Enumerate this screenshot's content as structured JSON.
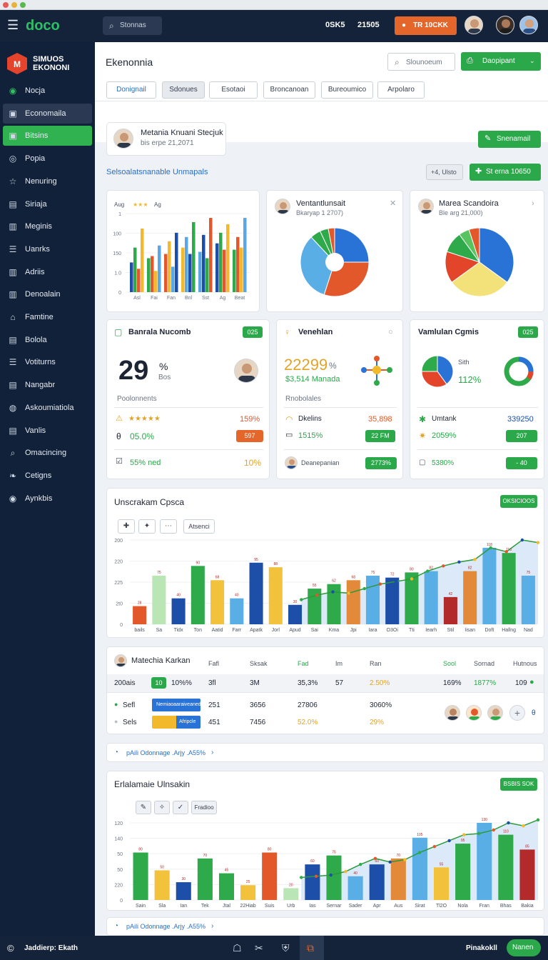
{
  "topbar": {
    "brand": "doco",
    "counter1": "0SK5",
    "counter2": "21505",
    "search_label": "Stonnas",
    "cta_label": "TR 10CKK"
  },
  "sidebar": {
    "logo_line1": "SIMUOS",
    "logo_line2": "EKONONI",
    "items": [
      {
        "label": "Nocja",
        "icon": "record-icon"
      },
      {
        "label": "Economaila",
        "icon": "square-icon"
      },
      {
        "label": "Bitsins",
        "icon": "square-icon"
      },
      {
        "label": "Popia",
        "icon": "compass-icon"
      },
      {
        "label": "Nenuring",
        "icon": "star-icon"
      },
      {
        "label": "Siriaja",
        "icon": "doc-icon"
      },
      {
        "label": "Meginis",
        "icon": "chart-icon"
      },
      {
        "label": "Uanrks",
        "icon": "list-icon"
      },
      {
        "label": "Adriis",
        "icon": "chart-icon"
      },
      {
        "label": "Denoalain",
        "icon": "chart-icon"
      },
      {
        "label": "Famtine",
        "icon": "home-icon"
      },
      {
        "label": "Bolola",
        "icon": "doc-icon"
      },
      {
        "label": "Votiturns",
        "icon": "list-icon"
      },
      {
        "label": "Nangabr",
        "icon": "doc-icon"
      },
      {
        "label": "Askoumiatiola",
        "icon": "globe-icon"
      },
      {
        "label": "Vanlis",
        "icon": "doc-icon"
      },
      {
        "label": "Omacincing",
        "icon": "search-icon"
      },
      {
        "label": "Cetigns",
        "icon": "leaf-icon"
      },
      {
        "label": "Aynkbis",
        "icon": "record-icon"
      }
    ]
  },
  "header": {
    "title": "Ekenonnia",
    "search_placeholder": "Slounoeum",
    "primary_label": "Daopipant"
  },
  "filters": [
    "Donignail",
    "Sdonues",
    "Esotaoi",
    "Broncanoan",
    "Bureoumico",
    "Arpolaro"
  ],
  "profile": {
    "name": "Metania Knuani Stecjuk",
    "sub": "bis erpe 21,2071"
  },
  "section": {
    "label": "Selsoalatsnanable Unmapals",
    "counter": "+4, Ulsto",
    "action": "St erna 10650",
    "top_button": "Snenamail"
  },
  "chart_data": [
    {
      "type": "bar",
      "title": "Aug",
      "legend": "Ag",
      "categories": [
        "Asl",
        "Fai",
        "Fan",
        "Bnl",
        "Sst",
        "Ag",
        "Beat"
      ],
      "yticks": [
        "1",
        "100",
        "150",
        "1.0",
        "0"
      ],
      "series": [
        {
          "values": [
            28,
            32,
            36,
            42,
            38,
            46,
            40
          ]
        },
        {
          "values": [
            42,
            34,
            48,
            52,
            54,
            56,
            52
          ]
        },
        {
          "values": [
            22,
            20,
            24,
            36,
            32,
            40,
            42
          ]
        },
        {
          "values": [
            60,
            44,
            56,
            66,
            70,
            64,
            70
          ]
        }
      ],
      "colors": [
        "#1e4fa8",
        "#2eaa4a",
        "#e2582a",
        "#f2b92c",
        "#5aa7e6"
      ]
    },
    {
      "type": "pie",
      "values": [
        25,
        30,
        33,
        5,
        4,
        3
      ],
      "colors": [
        "#2a73d6",
        "#e2582a",
        "#5aaee6",
        "#2eaa4a",
        "#2eaa4a",
        "#e2582a"
      ]
    },
    {
      "type": "pie",
      "values": [
        35,
        30,
        15,
        10,
        5,
        5
      ],
      "colors": [
        "#2a73d6",
        "#f3e27a",
        "#e2452a",
        "#2eaa4a",
        "#58c460",
        "#e2582a"
      ]
    },
    {
      "type": "bar-line",
      "title": "Unscrakam Cpsca",
      "action": "OKSICIOOS",
      "categories": [
        "bails",
        "Sa",
        "Tidx",
        "Ton",
        "Aatid",
        "Farr",
        "Apatk",
        "Jorl",
        "Apud",
        "Sai",
        "Kma",
        "Jpi",
        "Iara",
        "O3Oi",
        "Tti",
        "Iearh",
        "Stil",
        "Iisan",
        "Doft",
        "Hallng",
        "Nad"
      ],
      "yticks": [
        "200",
        "220",
        "225",
        "2t0",
        "0"
      ],
      "bars": [
        28,
        75,
        40,
        90,
        68,
        40,
        95,
        88,
        30,
        55,
        62,
        68,
        75,
        72,
        80,
        82,
        42,
        82,
        118,
        110,
        75
      ],
      "colors": [
        "#e2582a",
        "#b9e6b4",
        "#1e4fa8",
        "#2eaa4a",
        "#f2c23c",
        "#5aaee6",
        "#1e4fa8",
        "#f2c23c",
        "#1e4fa8",
        "#2eaa4a",
        "#2eaa4a",
        "#e2893a",
        "#5aaee6",
        "#1e4fa8",
        "#2eaa4a",
        "#5aaee6",
        "#b22a2a",
        "#e2893a",
        "#5aaee6",
        "#2eaa4a",
        "#5aaee6"
      ],
      "line": [
        38,
        45,
        50,
        48,
        55,
        62,
        66,
        70,
        82,
        90,
        96,
        100,
        118,
        112,
        130,
        126
      ]
    },
    {
      "type": "bar-line",
      "title": "Erlalamaie Ulnsakin",
      "action": "BSBIS SOK",
      "categories": [
        "Sain",
        "Sla",
        "Ian",
        "Tek",
        "Jtal",
        "22Hiab",
        "Suis",
        "Urb",
        "Ias",
        "Sernar",
        "Sader",
        "Apr",
        "Aus",
        "Sirat",
        "Tl2O",
        "Nola",
        "Fran",
        "Bhas",
        "Bakia"
      ],
      "yticks": [
        "120",
        "140",
        "50",
        "50",
        "220",
        "0"
      ],
      "bars": [
        80,
        50,
        30,
        70,
        45,
        25,
        80,
        20,
        60,
        75,
        40,
        60,
        70,
        105,
        55,
        95,
        130,
        110,
        85
      ],
      "colors": [
        "#2eaa4a",
        "#f2c23c",
        "#1e4fa8",
        "#2eaa4a",
        "#2eaa4a",
        "#f2c23c",
        "#e2582a",
        "#b9e6b4",
        "#1e4fa8",
        "#2eaa4a",
        "#5aaee6",
        "#1e4fa8",
        "#e2893a",
        "#5aaee6",
        "#f2c23c",
        "#2eaa4a",
        "#5aaee6",
        "#2eaa4a",
        "#b22a2a"
      ],
      "line": [
        38,
        40,
        42,
        48,
        60,
        70,
        64,
        68,
        80,
        90,
        100,
        110,
        112,
        118,
        130,
        125,
        135
      ]
    }
  ],
  "kpi": [
    {
      "title": "Banrala Nucomb",
      "badge": "025",
      "value": "29",
      "unit": "%",
      "sub": "Bos",
      "caption": "Poolonnents",
      "rows": [
        {
          "label": "★★★★★",
          "value": "159%"
        },
        {
          "label": "05.0%",
          "value": "597"
        },
        {
          "label": "55% ned",
          "value": "10%"
        }
      ]
    },
    {
      "title": "Venehlan",
      "badge": "",
      "value": "22299",
      "unit": "%",
      "sub": "$3,514 Manada",
      "caption": "Rnobolales",
      "rows": [
        {
          "label": "Dkelins",
          "value": "35,898"
        },
        {
          "label": "1515%",
          "value": "22 FM"
        },
        {
          "label": "Deanepanian",
          "value": "2773%"
        }
      ]
    },
    {
      "title": "Vamlulan Cgmis",
      "badge": "025",
      "value": "",
      "sub": "Sith",
      "pct": "112%",
      "caption": "",
      "rows": [
        {
          "label": "Umtank",
          "value": "339250"
        },
        {
          "label": "2059%",
          "value": "207"
        },
        {
          "label": "5380%",
          "value": "- 40"
        }
      ]
    }
  ],
  "mini_cards": [
    {
      "name": "Ventantlunsait",
      "sub": "Bkaryap 1 2707)"
    },
    {
      "name": "Marea Scandoira",
      "sub": "Ble arg 21,000)"
    }
  ],
  "chart_toolbar": {
    "a": "✚",
    "b": "✦",
    "c": "⋯",
    "d": "Atsenci",
    "e": "✎",
    "f": "✧",
    "g": "✓",
    "h": "Fradioo"
  },
  "table": {
    "title": "Matechia Karkan",
    "headers": [
      "Fafl",
      "Sksak",
      "Fad",
      "Im",
      "Ran",
      "Sool",
      "Sornad",
      "Hutnous"
    ],
    "row1": [
      "200ais",
      "10",
      "10%%",
      "3fl",
      "3M",
      "35,3%",
      "57",
      "2.50%",
      "169%",
      "1877%",
      "109"
    ],
    "row2": [
      "Sefl",
      "251",
      "3656",
      "27806",
      "3060%"
    ],
    "row3": [
      "Sels",
      "451",
      "7456",
      "52.0%",
      "29%"
    ],
    "bar_label1": "Nemiaoaaraiveaned",
    "bar_label2": "Afripcle"
  },
  "links": [
    "pAili Odonnage .Arjy .A55%"
  ],
  "footer": {
    "left": "Jaddierp: Ekath",
    "right_label": "Pinakokll",
    "action": "Nanen"
  }
}
